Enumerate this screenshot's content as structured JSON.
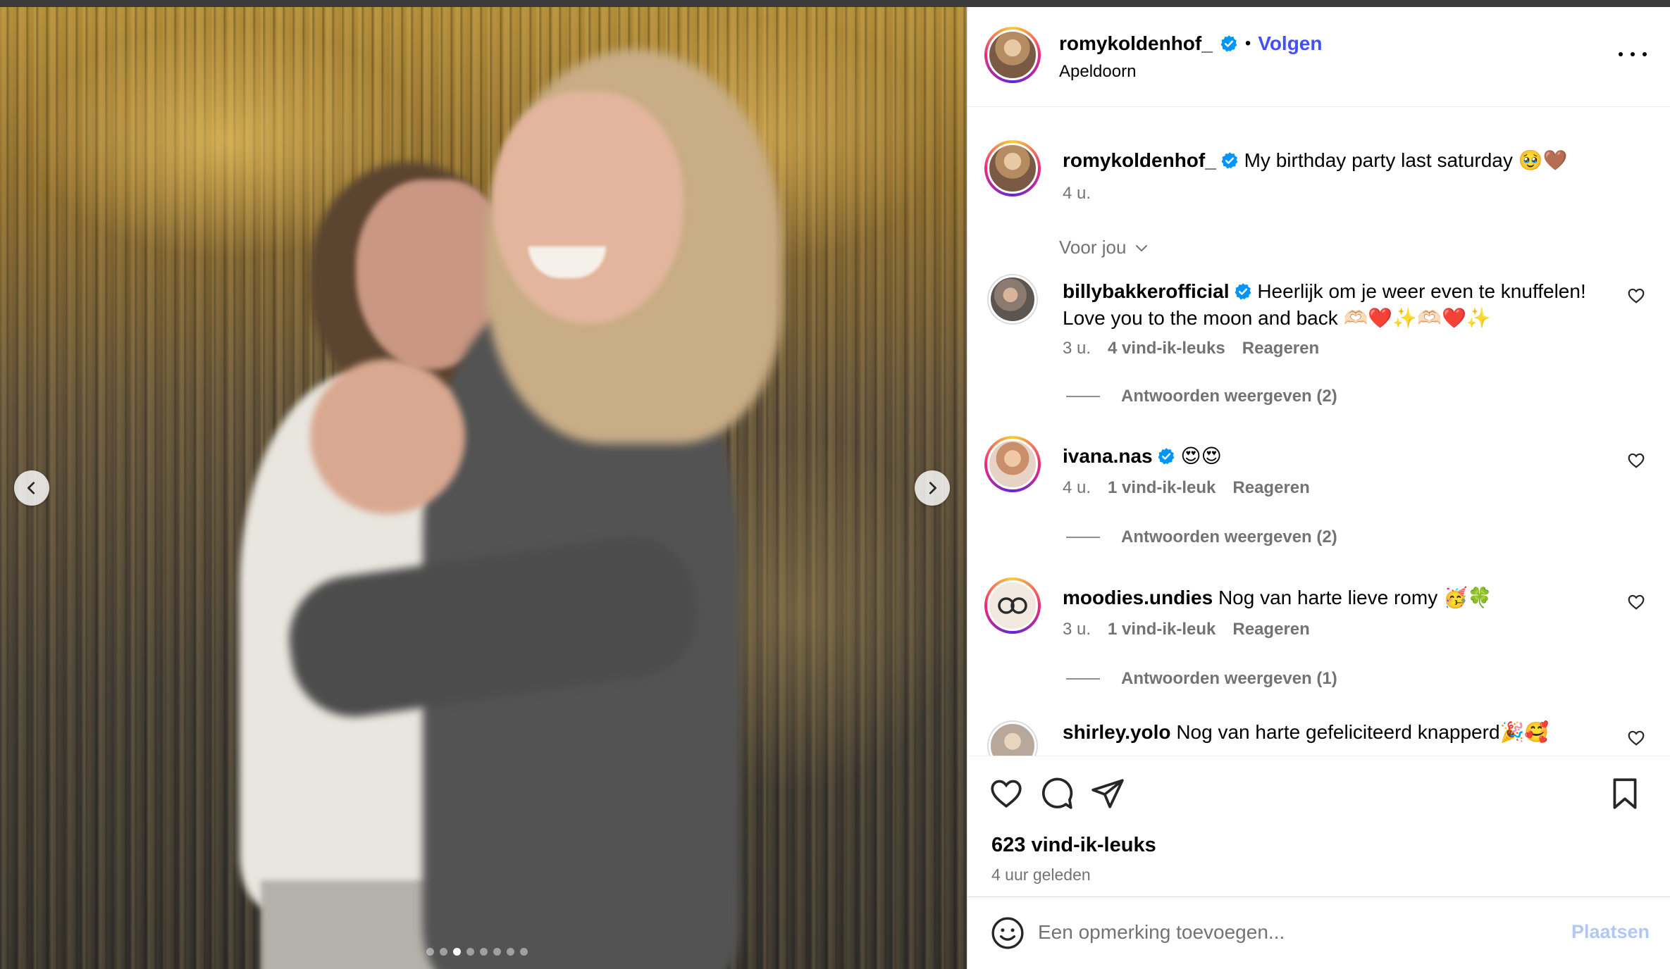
{
  "post": {
    "username": "romykoldenhof_",
    "follow_label": "Volgen",
    "separator": "•",
    "location": "Apeldoorn",
    "caption": "My birthday party last saturday 🥹🤎",
    "caption_time": "4 u.",
    "sort_label": "Voor jou",
    "likes": "623 vind-ik-leuks",
    "time_ago": "4 uur geleden",
    "carousel": {
      "total": 8,
      "active": 2
    }
  },
  "comments": [
    {
      "username": "billybakkerofficial",
      "verified": true,
      "text": "Heerlijk om je weer even te knuffelen! Love you to the moon and back 🫶🏻❤️✨🫶🏻❤️✨",
      "time": "3 u.",
      "likes": "4 vind-ik-leuks",
      "reply_label": "Reageren",
      "view_replies": "Antwoorden weergeven (2)"
    },
    {
      "username": "ivana.nas",
      "verified": true,
      "text": "😍😍",
      "time": "4 u.",
      "likes": "1 vind-ik-leuk",
      "reply_label": "Reageren",
      "view_replies": "Antwoorden weergeven (2)"
    },
    {
      "username": "moodies.undies",
      "verified": false,
      "text": "Nog van harte lieve romy 🥳🍀",
      "time": "3 u.",
      "likes": "1 vind-ik-leuk",
      "reply_label": "Reageren",
      "view_replies": "Antwoorden weergeven (1)"
    },
    {
      "username": "shirley.yolo",
      "verified": false,
      "text": "Nog van harte gefeliciteerd knapperd🎉🥰"
    }
  ],
  "composer": {
    "placeholder": "Een opmerking toevoegen...",
    "post_label": "Plaatsen"
  },
  "colors": {
    "link_blue": "#4150f7",
    "verified_blue": "#0095f6",
    "muted": "#737373",
    "post_disabled": "#b2c6f8"
  },
  "icons": [
    "chevron-left-icon",
    "chevron-right-icon",
    "more-icon",
    "verified-icon",
    "heart-icon",
    "comment-icon",
    "share-icon",
    "bookmark-icon",
    "smiley-icon",
    "chevron-down-icon"
  ]
}
